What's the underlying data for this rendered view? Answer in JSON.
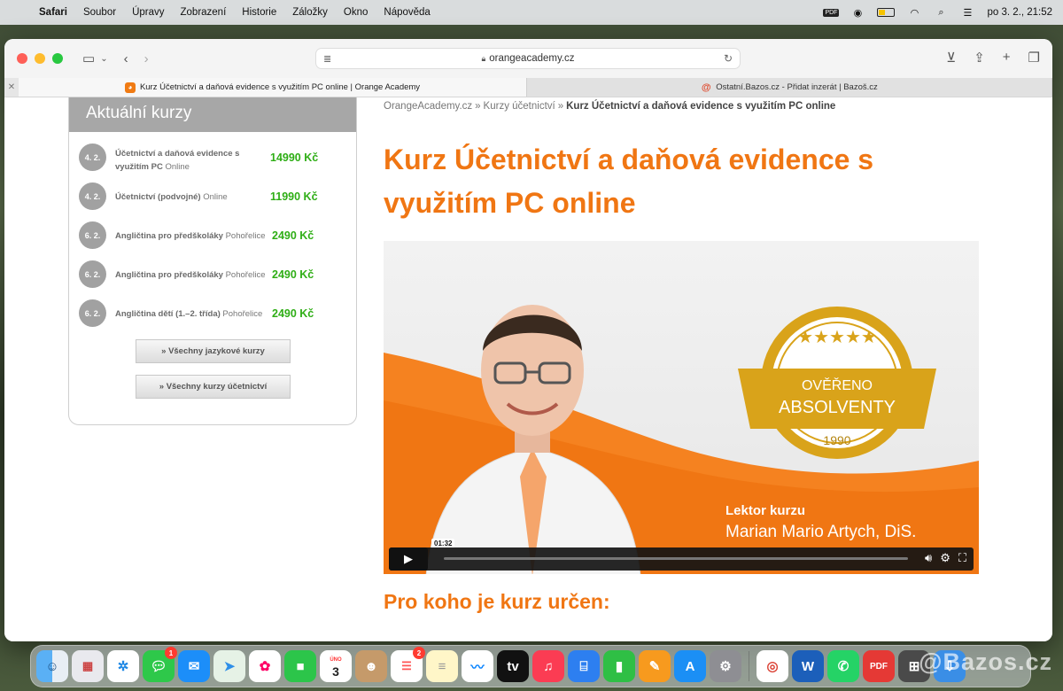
{
  "menubar": {
    "app_name": "Safari",
    "items": [
      "Soubor",
      "Úpravy",
      "Zobrazení",
      "Historie",
      "Záložky",
      "Okno",
      "Nápověda"
    ],
    "datetime": "po 3. 2.,  21:52",
    "pdf_label": "PDF"
  },
  "browser": {
    "url": "orangeacademy.cz",
    "tabs": [
      {
        "title": "Kurz Účetnictví a daňová evidence s využitím PC online | Orange Academy",
        "active": true
      },
      {
        "title": "Ostatní.Bazos.cz - Přidat inzerát | Bazoš.cz",
        "active": false
      }
    ]
  },
  "sidebar": {
    "heading": "Aktuální kurzy",
    "courses": [
      {
        "date": "4. 2.",
        "name": "Účetnictví a daňová evidence s využitím PC",
        "location": "Online",
        "price": "14990 Kč"
      },
      {
        "date": "4. 2.",
        "name": "Účetnictví (podvojné)",
        "location": "Online",
        "price": "11990 Kč"
      },
      {
        "date": "6. 2.",
        "name": "Angličtina pro předškoláky",
        "location": "Pohořelice",
        "price": "2490 Kč"
      },
      {
        "date": "6. 2.",
        "name": "Angličtina pro předškoláky",
        "location": "Pohořelice",
        "price": "2490 Kč"
      },
      {
        "date": "6. 2.",
        "name": "Angličtina dětí (1.–2. třída)",
        "location": "Pohořelice",
        "price": "2490 Kč"
      }
    ],
    "buttons": [
      "» Všechny jazykové kurzy",
      "» Všechny kurzy účetnictví"
    ]
  },
  "breadcrumb": {
    "items": [
      "OrangeAcademy.cz",
      "Kurzy účetnictví"
    ],
    "separator": "»",
    "current": "Kurz Účetnictví a daňová evidence s využitím PC online"
  },
  "page": {
    "title": "Kurz Účetnictví a daňová evidence s využitím PC online",
    "section_heading": "Pro koho je kurz určen:"
  },
  "video": {
    "badge_top": "OVĚŘENO",
    "badge_main": "ABSOLVENTY",
    "badge_year": "1990",
    "lecturer_label": "Lektor kurzu",
    "lecturer_name": "Marian Mario Artych, DiS.",
    "time": "01:32"
  },
  "dock": {
    "calendar_month": "ÚNO",
    "calendar_day": "3",
    "messages_badge": "1",
    "reminders_badge": "2",
    "pdf_label": "PDF",
    "word_label": "W"
  },
  "watermark": "@Bazos.cz",
  "colors": {
    "accent": "#f07613",
    "price": "#2fae16"
  }
}
